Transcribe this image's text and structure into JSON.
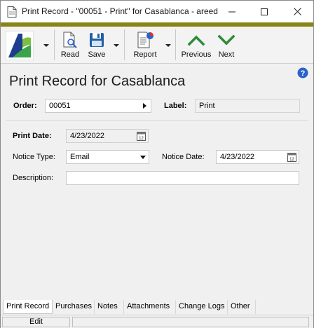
{
  "window": {
    "title": "Print Record - \"00051 - Print\" for Casablanca - areed"
  },
  "titlebar_buttons": {
    "minimize_icon": "minimize-icon",
    "maximize_icon": "maximize-icon",
    "close_icon": "close-icon"
  },
  "toolbar": {
    "read_label": "Read",
    "save_label": "Save",
    "report_label": "Report",
    "previous_label": "Previous",
    "next_label": "Next"
  },
  "colors": {
    "accent_strip": "#8a8416",
    "nav_arrow": "#2e8b3a",
    "help": "#2a62c9",
    "save_icon": "#1f5fa8"
  },
  "form": {
    "title": "Print Record for Casablanca",
    "order_label": "Order:",
    "order_value": "00051",
    "label_label": "Label:",
    "label_value": "Print",
    "print_date_label": "Print Date:",
    "print_date_value": "4/23/2022",
    "notice_type_label": "Notice Type:",
    "notice_type_value": "Email",
    "notice_date_label": "Notice Date:",
    "notice_date_value": "4/23/2022",
    "description_label": "Description:",
    "description_value": ""
  },
  "tabs": [
    {
      "label": "Print Record",
      "active": true
    },
    {
      "label": "Purchases",
      "active": false
    },
    {
      "label": "Notes",
      "active": false
    },
    {
      "label": "Attachments",
      "active": false
    },
    {
      "label": "Change Logs",
      "active": false
    },
    {
      "label": "Other",
      "active": false
    }
  ],
  "status": {
    "mode": "Edit"
  }
}
